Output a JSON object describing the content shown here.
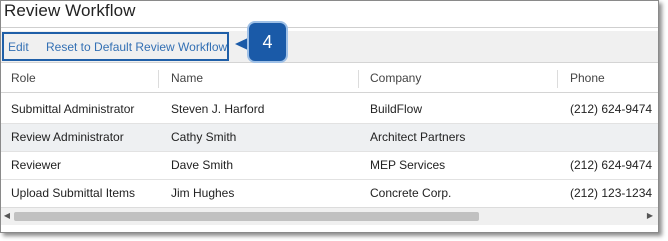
{
  "panel": {
    "title": "Review Workflow"
  },
  "toolbar": {
    "edit_label": "Edit",
    "reset_label": "Reset to Default Review Workflow"
  },
  "callout": {
    "number": "4",
    "color": "#1a5aa8"
  },
  "grid": {
    "columns": [
      "Role",
      "Name",
      "Company",
      "Phone"
    ],
    "rows": [
      {
        "role": "Submittal Administrator",
        "name": "Steven J. Harford",
        "company": "BuildFlow",
        "phone": "(212) 624-9474"
      },
      {
        "role": "Review Administrator",
        "name": "Cathy Smith",
        "company": "Architect Partners",
        "phone": ""
      },
      {
        "role": "Reviewer",
        "name": "Dave Smith",
        "company": "MEP Services",
        "phone": "(212) 624-9474"
      },
      {
        "role": "Upload Submittal Items",
        "name": "Jim Hughes",
        "company": "Concrete Corp.",
        "phone": "(212) 123-1234"
      }
    ]
  },
  "scrollbar": {
    "left_icon": "arrow-left-icon",
    "right_icon": "arrow-right-icon"
  }
}
